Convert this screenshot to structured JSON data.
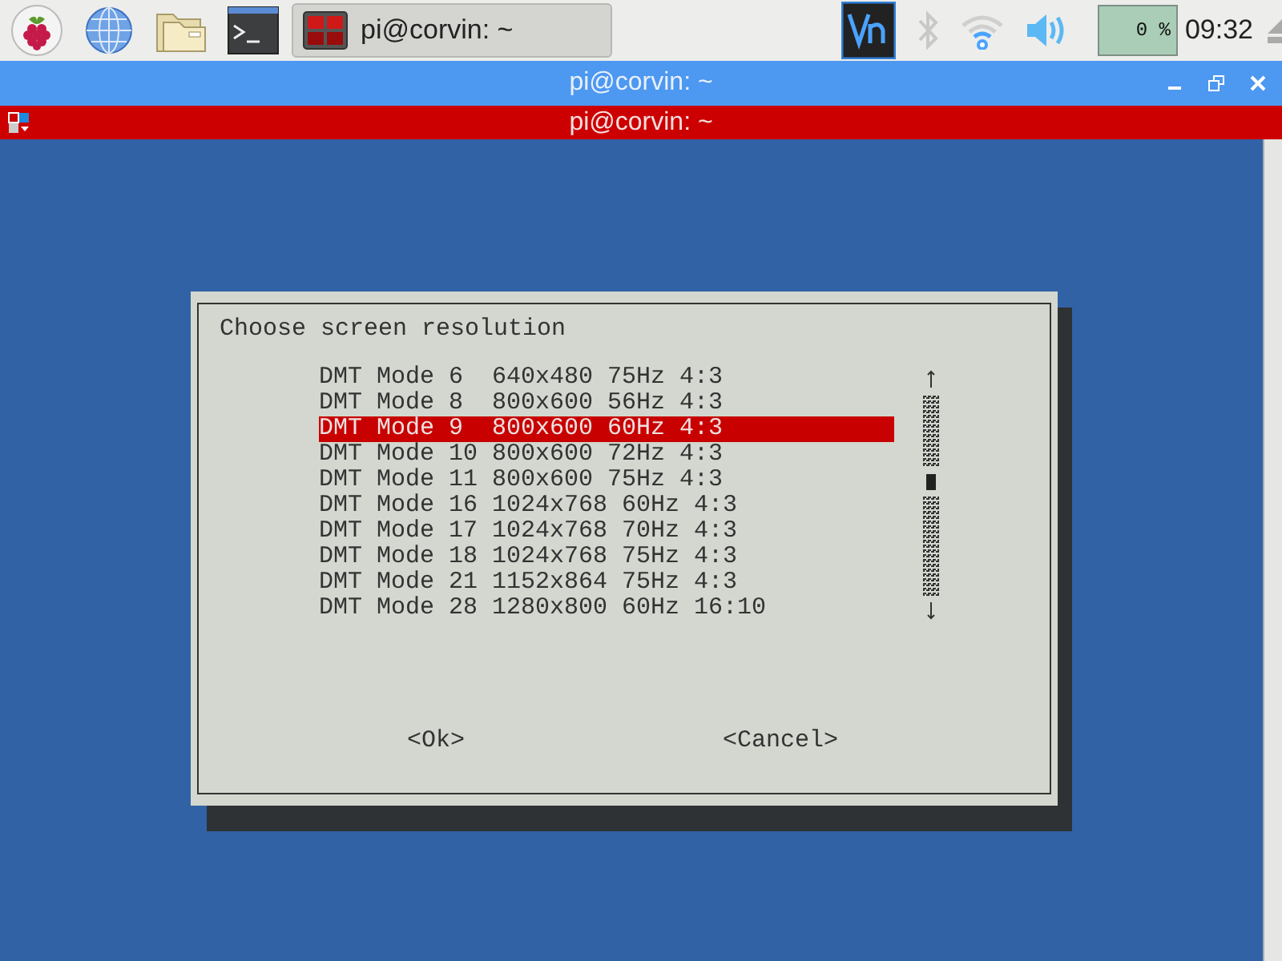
{
  "taskbar": {
    "window_button": {
      "title": "pi@corvin: ~",
      "selected": true
    },
    "cpu": "0 %",
    "clock": "09:32"
  },
  "window": {
    "title": "pi@corvin: ~"
  },
  "terminal": {
    "title": "pi@corvin: ~"
  },
  "dialog": {
    "title": "Choose screen resolution",
    "items": [
      {
        "label": "DMT Mode 6  640x480 75Hz 4:3",
        "selected": false
      },
      {
        "label": "DMT Mode 8  800x600 56Hz 4:3",
        "selected": false
      },
      {
        "label": "DMT Mode 9  800x600 60Hz 4:3",
        "selected": true
      },
      {
        "label": "DMT Mode 10 800x600 72Hz 4:3",
        "selected": false
      },
      {
        "label": "DMT Mode 11 800x600 75Hz 4:3",
        "selected": false
      },
      {
        "label": "DMT Mode 16 1024x768 60Hz 4:3",
        "selected": false
      },
      {
        "label": "DMT Mode 17 1024x768 70Hz 4:3",
        "selected": false
      },
      {
        "label": "DMT Mode 18 1024x768 75Hz 4:3",
        "selected": false
      },
      {
        "label": "DMT Mode 21 1152x864 75Hz 4:3",
        "selected": false
      },
      {
        "label": "DMT Mode 28 1280x800 60Hz 16:10",
        "selected": false
      }
    ],
    "buttons": [
      "<Ok>",
      "<Cancel>"
    ]
  }
}
